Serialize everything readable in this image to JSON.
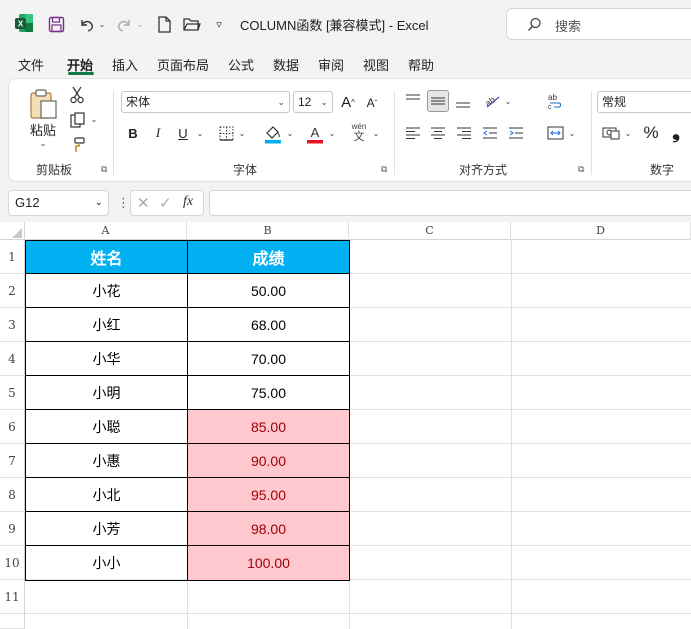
{
  "app": {
    "title": "COLUMN函数  [兼容模式]  -  Excel",
    "search_label": "搜索"
  },
  "menu": {
    "tabs": [
      "文件",
      "开始",
      "插入",
      "页面布局",
      "公式",
      "数据",
      "审阅",
      "视图",
      "帮助"
    ],
    "active": "开始"
  },
  "ribbon": {
    "clipboard": {
      "paste_label": "粘贴",
      "group_label": "剪贴板"
    },
    "font": {
      "font_name": "宋体",
      "font_size": "12",
      "group_label": "字体",
      "bold": "B",
      "italic": "I",
      "underline": "U",
      "grow": "A",
      "shrink": "A",
      "phonetic": "wén",
      "phonetic_sub": "文",
      "font_color": "#e81123",
      "fill_color": "#00b0f0"
    },
    "alignment": {
      "group_label": "对齐方式"
    },
    "number": {
      "format": "常规",
      "group_label": "数字",
      "percent": "%"
    }
  },
  "formula_bar": {
    "name_box": "G12",
    "fx": "fx",
    "formula": ""
  },
  "sheet": {
    "columns": [
      "A",
      "B",
      "C",
      "D"
    ],
    "rows": [
      "1",
      "2",
      "3",
      "4",
      "5",
      "6",
      "7",
      "8",
      "9",
      "10",
      "11"
    ],
    "table": {
      "headers": [
        "姓名",
        "成绩"
      ],
      "rows": [
        {
          "name": "小花",
          "score": "50.00",
          "highlight": false
        },
        {
          "name": "小红",
          "score": "68.00",
          "highlight": false
        },
        {
          "name": "小华",
          "score": "70.00",
          "highlight": false
        },
        {
          "name": "小明",
          "score": "75.00",
          "highlight": false
        },
        {
          "name": "小聪",
          "score": "85.00",
          "highlight": true
        },
        {
          "name": "小惠",
          "score": "90.00",
          "highlight": true
        },
        {
          "name": "小北",
          "score": "95.00",
          "highlight": true
        },
        {
          "name": "小芳",
          "score": "98.00",
          "highlight": true
        },
        {
          "name": "小小",
          "score": "100.00",
          "highlight": true
        }
      ]
    },
    "colors": {
      "header_fill": "#00b0f0",
      "highlight_fill": "#ffc7ce",
      "highlight_text": "#9c0006"
    }
  }
}
